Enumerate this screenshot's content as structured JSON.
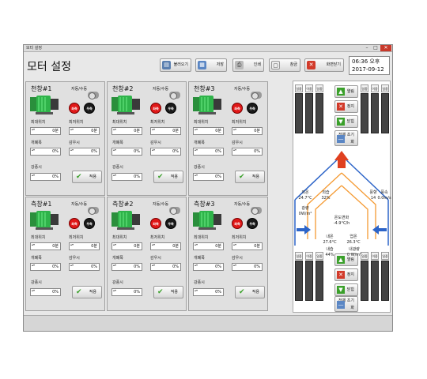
{
  "window": {
    "title": "모터 설정",
    "min_icon": "minimize-icon",
    "max_icon": "maximize-icon",
    "close_icon": "close-icon"
  },
  "header": {
    "page_title": "모터 설정",
    "buttons": [
      {
        "label": "불러오기",
        "icon": "load-icon"
      },
      {
        "label": "저장",
        "icon": "save-icon"
      },
      {
        "label": "인쇄",
        "icon": "print-icon"
      },
      {
        "label": "참금",
        "icon": "lock-icon"
      },
      {
        "label": "화면닫기",
        "icon": "close-screen-icon"
      }
    ],
    "clock": {
      "time": "06:36 오후",
      "date": "2017-09-12"
    }
  },
  "panels": [
    {
      "title": "천창#1",
      "mode_label": "자동/수동",
      "left_label": "좌측",
      "right_label": "우측",
      "max_pos_label": "최대위치",
      "max_pos_label2": "최저위치",
      "open_label": "개폐폭",
      "rain_label": "감우시",
      "wind_label": "강풍시",
      "max_pos": "0분",
      "min_pos": "0분",
      "open_width": "0%",
      "rain": "0%",
      "wind": "0%",
      "apply_label": "적용"
    },
    {
      "title": "천창#2",
      "mode_label": "자동/수동",
      "left_label": "좌측",
      "right_label": "우측",
      "max_pos_label": "최대위치",
      "max_pos_label2": "최저위치",
      "open_label": "개폐폭",
      "rain_label": "감우시",
      "wind_label": "강풍시",
      "max_pos": "0분",
      "min_pos": "0분",
      "open_width": "0%",
      "rain": "0%",
      "wind": "0%",
      "apply_label": "적용"
    },
    {
      "title": "천창#3",
      "mode_label": "자동/수동",
      "left_label": "좌측",
      "right_label": "우측",
      "max_pos_label": "최대위치",
      "max_pos_label2": "최저위치",
      "open_label": "개폐폭",
      "rain_label": "감우시",
      "wind_label": "강풍시",
      "max_pos": "0분",
      "min_pos": "0분",
      "open_width": "0%",
      "rain": "0%",
      "wind": "0%",
      "apply_label": "적용"
    },
    {
      "title": "측창#1",
      "mode_label": "자동/수동",
      "left_label": "좌측",
      "right_label": "우측",
      "max_pos_label": "최대위치",
      "max_pos_label2": "최저위치",
      "open_label": "개폐폭",
      "rain_label": "감우시",
      "wind_label": "강풍시",
      "max_pos": "0분",
      "min_pos": "0분",
      "open_width": "0%",
      "rain": "0%",
      "wind": "0%",
      "apply_label": "적용"
    },
    {
      "title": "측창#2",
      "mode_label": "자동/수동",
      "left_label": "좌측",
      "right_label": "우측",
      "max_pos_label": "최대위치",
      "max_pos_label2": "최저위치",
      "open_label": "개폐폭",
      "rain_label": "감우시",
      "wind_label": "강풍시",
      "max_pos": "0분",
      "min_pos": "0분",
      "open_width": "0%",
      "rain": "0%",
      "wind": "0%",
      "apply_label": "적용"
    },
    {
      "title": "측창#3",
      "mode_label": "자동/수동",
      "left_label": "좌측",
      "right_label": "우측",
      "max_pos_label": "최대위치",
      "max_pos_label2": "최저위치",
      "open_label": "개폐폭",
      "rain_label": "감우시",
      "wind_label": "강풍시",
      "max_pos": "0분",
      "min_pos": "0분",
      "open_width": "0%",
      "rain": "0%",
      "wind": "0%",
      "apply_label": "적용"
    }
  ],
  "gauges_top": [
    "일중",
    "이중",
    "일중",
    "일중",
    "이중",
    "일중"
  ],
  "gauges_bottom": [
    "일중",
    "이중",
    "일중",
    "일중",
    "이중",
    "일중"
  ],
  "controls_top": [
    {
      "label": "열림",
      "icon": "open-up-icon"
    },
    {
      "label": "정지",
      "icon": "stop-icon"
    },
    {
      "label": "닫힘",
      "icon": "close-down-icon"
    },
    {
      "label": "전체 초기화",
      "icon": "reset-icon"
    }
  ],
  "controls_bottom": [
    {
      "label": "열림",
      "icon": "open-up-icon"
    },
    {
      "label": "정지",
      "icon": "stop-icon"
    },
    {
      "label": "닫힘",
      "icon": "close-down-icon"
    },
    {
      "label": "전체 초기화",
      "icon": "reset-icon"
    }
  ],
  "environment": {
    "outside_temp_label": "외온",
    "outside_temp": "24.7°C",
    "outside_hum_label": "외습",
    "outside_hum": "32%",
    "wind_dir_label": "풍향",
    "wind_dir": "14",
    "wind_speed_label": "풍속",
    "wind_speed": "0.0m/s",
    "solar_label": "광량",
    "solar": "0W/m²",
    "temp_change_label": "온도변화",
    "temp_change": "-4.9°C/h",
    "inside_temp_label": "내온",
    "inside_temp": "27.6°C",
    "leaf_temp_label": "엽온",
    "leaf_temp": "26.3°C",
    "inside_hum_label": "내습",
    "inside_hum": "44%",
    "inside_solar_label": "내광량",
    "inside_solar": "0 W/m²"
  },
  "colors": {
    "motor_green": "#2fb34a",
    "left_red": "#e01818",
    "right_black": "#1a1a1a",
    "warm_arrow": "#f59a32",
    "cool_arrow": "#2c64c8"
  }
}
